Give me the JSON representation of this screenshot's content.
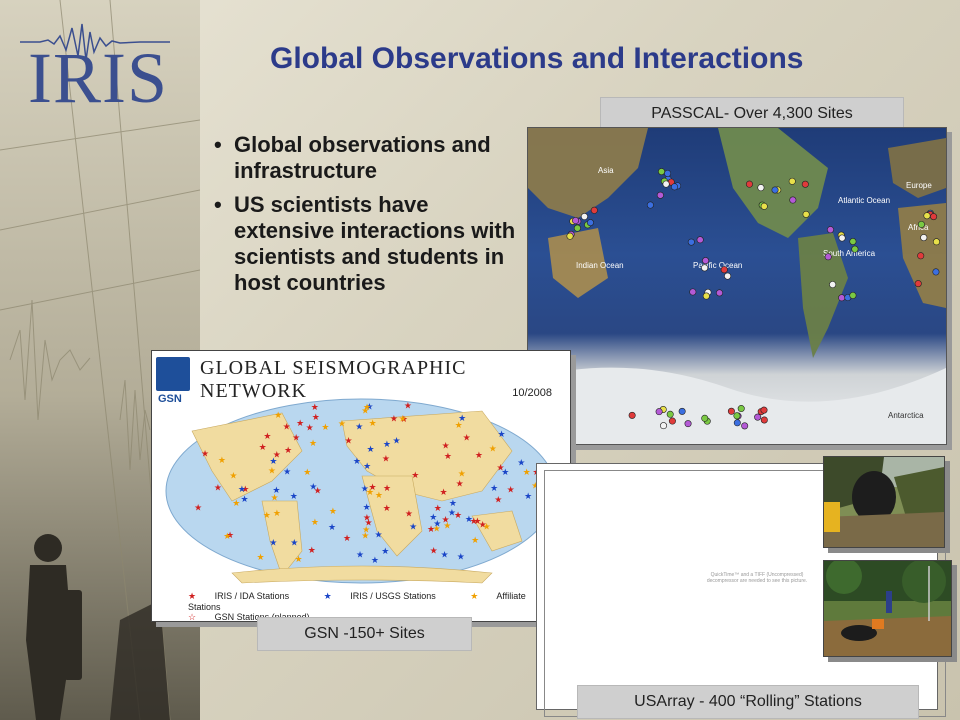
{
  "logo": {
    "text": "IRIS"
  },
  "title": "Global Observations and Interactions",
  "bullets": [
    "Global observations and infrastructure",
    "US scientists have extensive interactions with scientists and students in host countries"
  ],
  "labels": {
    "passcal": "PASSCAL- Over 4,300 Sites",
    "gsn": "GSN -150+ Sites",
    "usarray": "USArray - 400 “Rolling” Stations"
  },
  "passcal_map": {
    "places": [
      "Asia",
      "Europe",
      "Africa",
      "Atlantic Ocean",
      "Indian Ocean",
      "Pacific Ocean",
      "South America",
      "Antarctica"
    ]
  },
  "gsn_map": {
    "header": "GLOBAL SEISMOGRAPHIC NETWORK",
    "date": "10/2008",
    "logo_text": "GSN",
    "legend": [
      "IRIS / IDA Stations",
      "IRIS / USGS Stations",
      "Affiliate Stations",
      "GSN Stations (planned)"
    ]
  },
  "usarray_placeholder": "QuickTime™ and a TIFF (Uncompressed) decompressor are needed to see this picture.",
  "colors": {
    "title": "#2c3b8a",
    "logo": "#3b4f8f",
    "label_bg": "#cfcfcf"
  }
}
